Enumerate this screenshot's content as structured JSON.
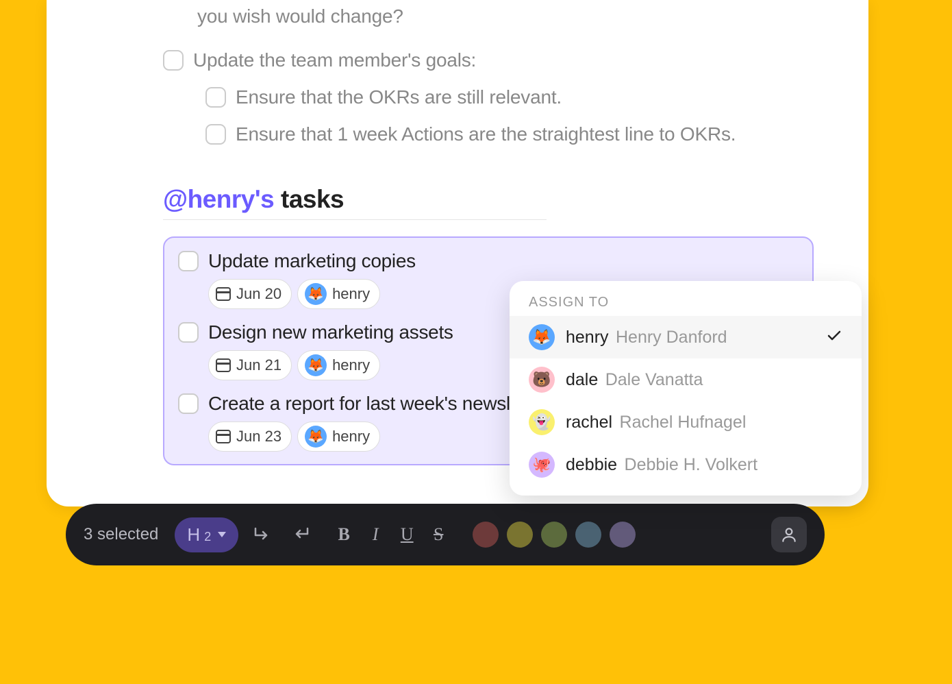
{
  "partial_text": "you wish would change?",
  "goal_main": "Update the team member's goals:",
  "goal_sub_1": "Ensure that the OKRs are still relevant.",
  "goal_sub_2": "Ensure that 1 week Actions are the straightest line to OKRs.",
  "section": {
    "mention": "@henry's",
    "rest": " tasks"
  },
  "tasks": [
    {
      "title": "Update marketing copies",
      "date": "Jun 20",
      "assignee": "henry"
    },
    {
      "title": "Design new marketing assets",
      "date": "Jun 21",
      "assignee": "henry"
    },
    {
      "title": "Create a report for last week's newsletter",
      "date": "Jun 23",
      "assignee": "henry"
    }
  ],
  "assign_popup": {
    "label": "ASSIGN TO",
    "people": [
      {
        "handle": "henry",
        "full": "Henry Danford",
        "avatar": "henry",
        "selected": true
      },
      {
        "handle": "dale",
        "full": "Dale Vanatta",
        "avatar": "dale",
        "selected": false
      },
      {
        "handle": "rachel",
        "full": "Rachel Hufnagel",
        "avatar": "rachel",
        "selected": false
      },
      {
        "handle": "debbie",
        "full": "Debbie H. Volkert",
        "avatar": "debbie",
        "selected": false
      }
    ]
  },
  "toolbar": {
    "selection_text": "3 selected",
    "heading_label": "H",
    "heading_level": "2",
    "bold": "B",
    "italic": "I",
    "underline": "U",
    "strike": "S",
    "colors": [
      "#6d3a3a",
      "#7a7430",
      "#5c6b3d",
      "#4a6272",
      "#625a7a"
    ]
  }
}
